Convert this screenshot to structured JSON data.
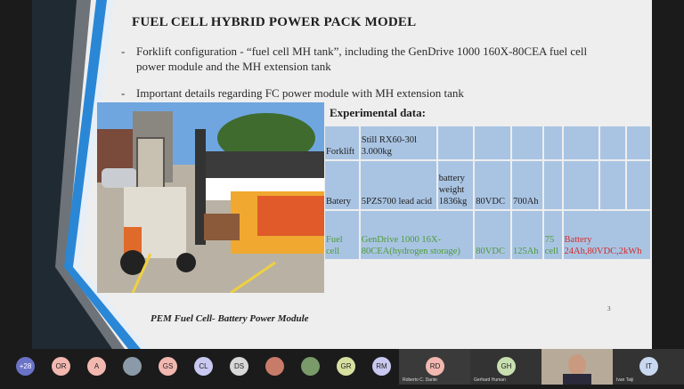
{
  "slide": {
    "title": "FUEL CELL HYBRID POWER PACK MODEL",
    "bullets": [
      "Forklift  configuration - “fuel cell MH tank”, including the GenDrive 1000 160X-80CEA fuel cell power module and the MH extension tank",
      "Important details regarding FC power module with MH extension tank"
    ],
    "bullet_marker": "-",
    "experimental_title": "Experimental data:",
    "caption": "PEM Fuel Cell- Battery Power Module",
    "page_number": "3",
    "table": {
      "rows": [
        [
          "Forklift",
          "Still RX60-30l 3.000kg",
          "",
          "",
          "",
          "",
          "",
          "",
          ""
        ],
        [
          "Batery",
          "5PZS700 lead acid",
          "battery weight 1836kg",
          "80VDC",
          "700Ah",
          "",
          "",
          "",
          ""
        ],
        [
          "Fuel cell",
          "GenDrive 1000 16X-80CEA(hydrogen storage)",
          "",
          "80VDC",
          "125Ah",
          "75 cell",
          "Battery 24Ah,80VDC,2kWh",
          "",
          ""
        ]
      ]
    }
  },
  "participants": [
    {
      "initials": "+28",
      "color": "#6b73c8"
    },
    {
      "initials": "OR",
      "color": "#f2b8b0"
    },
    {
      "initials": "A",
      "color": "#f2b8b0"
    },
    {
      "initials": "",
      "color": "#8a9aa8"
    },
    {
      "initials": "GS",
      "color": "#f2b8b0"
    },
    {
      "initials": "CL",
      "color": "#c8c8f0"
    },
    {
      "initials": "DS",
      "color": "#d8d8d8"
    },
    {
      "initials": "",
      "color": "#c97b6a"
    },
    {
      "initials": "",
      "color": "#7a9a6a"
    },
    {
      "initials": "GR",
      "color": "#d8e0a0"
    },
    {
      "initials": "RM",
      "color": "#c8c8f0"
    }
  ],
  "video_tiles": [
    {
      "initials": "RD",
      "name": "Roberto C. Dante",
      "color": "#f2b8b0"
    },
    {
      "initials": "GH",
      "name": "Gerhard Human",
      "color": "#c8e0b0"
    },
    {
      "initials": "",
      "name": "",
      "color": "#666"
    },
    {
      "initials": "IT",
      "name": "Ivan Taiji",
      "color": "#c8d8f0"
    }
  ]
}
